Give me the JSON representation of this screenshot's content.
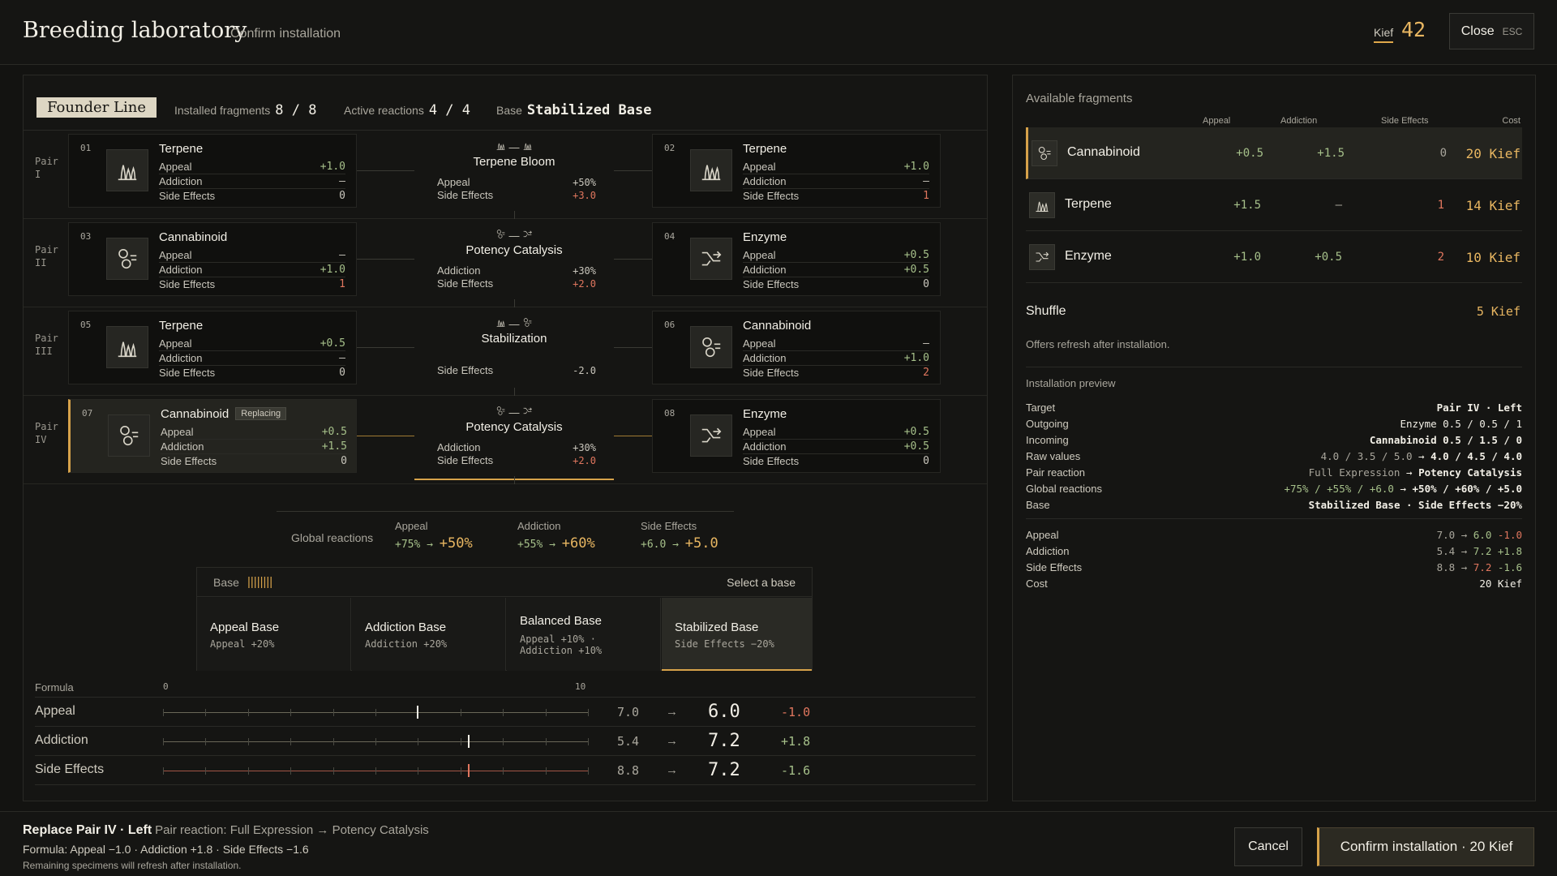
{
  "header": {
    "title": "Breeding laboratory",
    "subtitle": "Confirm installation",
    "kief_label": "Kief",
    "kief_value": "42",
    "close_label": "Close",
    "close_key": "ESC"
  },
  "line": {
    "badge": "Founder Line",
    "installed_label": "Installed fragments",
    "installed_value": "8 / 8",
    "reactions_label": "Active reactions",
    "reactions_value": "4 / 4",
    "base_label": "Base",
    "base_value": "Stabilized Base"
  },
  "pairs": [
    {
      "label": "Pair I",
      "left": {
        "num": "01",
        "name": "Terpene",
        "icon": "terpene-icon",
        "stats": [
          {
            "k": "Appeal",
            "v": "+1.0"
          },
          {
            "k": "Addiction",
            "v": "–"
          },
          {
            "k": "Side Effects",
            "v": "0"
          }
        ]
      },
      "reaction": {
        "mini_left": "terpene",
        "mini_right": "terpene",
        "name": "Terpene Bloom",
        "stats": [
          {
            "k": "Appeal",
            "v": "+50%"
          },
          {
            "k": "Side Effects",
            "v": "+3.0"
          }
        ]
      },
      "right": {
        "num": "02",
        "name": "Terpene",
        "icon": "terpene-icon",
        "stats": [
          {
            "k": "Appeal",
            "v": "+1.0"
          },
          {
            "k": "Addiction",
            "v": "–"
          },
          {
            "k": "Side Effects",
            "v": "1"
          }
        ]
      }
    },
    {
      "label": "Pair II",
      "left": {
        "num": "03",
        "name": "Cannabinoid",
        "icon": "cannabinoid-icon",
        "stats": [
          {
            "k": "Appeal",
            "v": "–"
          },
          {
            "k": "Addiction",
            "v": "+1.0"
          },
          {
            "k": "Side Effects",
            "v": "1"
          }
        ]
      },
      "reaction": {
        "mini_left": "cannabinoid",
        "mini_right": "enzyme",
        "name": "Potency Catalysis",
        "stats": [
          {
            "k": "Addiction",
            "v": "+30%"
          },
          {
            "k": "Side Effects",
            "v": "+2.0"
          }
        ]
      },
      "right": {
        "num": "04",
        "name": "Enzyme",
        "icon": "enzyme-icon",
        "stats": [
          {
            "k": "Appeal",
            "v": "+0.5"
          },
          {
            "k": "Addiction",
            "v": "+0.5"
          },
          {
            "k": "Side Effects",
            "v": "0"
          }
        ]
      }
    },
    {
      "label": "Pair III",
      "left": {
        "num": "05",
        "name": "Terpene",
        "icon": "terpene-icon",
        "stats": [
          {
            "k": "Appeal",
            "v": "+0.5"
          },
          {
            "k": "Addiction",
            "v": "–"
          },
          {
            "k": "Side Effects",
            "v": "0"
          }
        ]
      },
      "reaction": {
        "mini_left": "terpene",
        "mini_right": "cannabinoid",
        "name": "Stabilization",
        "stats": [
          {
            "k": "Side Effects",
            "v": "-2.0"
          }
        ]
      },
      "right": {
        "num": "06",
        "name": "Cannabinoid",
        "icon": "cannabinoid-icon",
        "stats": [
          {
            "k": "Appeal",
            "v": "–"
          },
          {
            "k": "Addiction",
            "v": "+1.0"
          },
          {
            "k": "Side Effects",
            "v": "2"
          }
        ]
      }
    },
    {
      "label": "Pair IV",
      "left": {
        "num": "07",
        "name": "Cannabinoid",
        "tag": "Replacing",
        "icon": "cannabinoid-icon",
        "stats": [
          {
            "k": "Appeal",
            "v": "+0.5"
          },
          {
            "k": "Addiction",
            "v": "+1.5"
          },
          {
            "k": "Side Effects",
            "v": "0"
          }
        ]
      },
      "reaction": {
        "mini_left": "cannabinoid",
        "mini_right": "enzyme",
        "name": "Potency Catalysis",
        "stats": [
          {
            "k": "Addiction",
            "v": "+30%"
          },
          {
            "k": "Side Effects",
            "v": "+2.0"
          }
        ]
      },
      "right": {
        "num": "08",
        "name": "Enzyme",
        "icon": "enzyme-icon",
        "stats": [
          {
            "k": "Appeal",
            "v": "+0.5"
          },
          {
            "k": "Addiction",
            "v": "+0.5"
          },
          {
            "k": "Side Effects",
            "v": "0"
          }
        ]
      }
    }
  ],
  "global_reactions": {
    "label": "Global reactions",
    "cols": [
      {
        "k": "Appeal",
        "from": "+75%",
        "to": "+50%"
      },
      {
        "k": "Addiction",
        "from": "+55%",
        "to": "+60%"
      },
      {
        "k": "Side Effects",
        "from": "+6.0",
        "to": "+5.0"
      }
    ]
  },
  "base": {
    "label": "Base",
    "ticks": "||||||||",
    "select_label": "Select a base",
    "options": [
      {
        "name": "Appeal Base",
        "desc1": "Appeal +20%",
        "desc2": ""
      },
      {
        "name": "Addiction Base",
        "desc1": "Addiction +20%",
        "desc2": ""
      },
      {
        "name": "Balanced Base",
        "desc1": "Appeal +10% ·",
        "desc2": "Addiction +10%"
      },
      {
        "name": "Stabilized Base",
        "desc1": "Side Effects −20%",
        "desc2": ""
      }
    ]
  },
  "formula": {
    "label": "Formula",
    "min_label": "0",
    "max_label": "10",
    "scale_max": 10,
    "rows": [
      {
        "name": "Appeal",
        "old": "7.0",
        "new": "6.0",
        "value": 6.0,
        "delta": "-1.0",
        "delta_color": "#e0765e",
        "arrow": "→"
      },
      {
        "name": "Addiction",
        "old": "5.4",
        "new": "7.2",
        "value": 7.2,
        "delta": "+1.8",
        "delta_color": "#a6c08a",
        "arrow": "→"
      },
      {
        "name": "Side Effects",
        "old": "8.8",
        "new": "7.2",
        "value": 7.2,
        "delta": "-1.6",
        "delta_color": "#a6c08a",
        "arrow": "→"
      }
    ]
  },
  "available": {
    "title": "Available fragments",
    "headers": [
      "Appeal",
      "Addiction",
      "Side Effects",
      "Cost"
    ],
    "items": [
      {
        "name": "Cannabinoid",
        "icon": "cannabinoid-icon",
        "appeal": "+0.5",
        "addiction": "+1.5",
        "side": "0",
        "side_color": "#a9a69c",
        "cost": "20 Kief"
      },
      {
        "name": "Terpene",
        "icon": "terpene-icon",
        "appeal": "+1.5",
        "addiction": "–",
        "side": "1",
        "side_color": "#e0765e",
        "cost": "14 Kief"
      },
      {
        "name": "Enzyme",
        "icon": "enzyme-icon",
        "appeal": "+1.0",
        "addiction": "+0.5",
        "side": "2",
        "side_color": "#e0765e",
        "cost": "10 Kief"
      }
    ],
    "shuffle_label": "Shuffle",
    "shuffle_cost": "5 Kief",
    "shuffle_desc": "Offers refresh after installation."
  },
  "preview": {
    "title": "Installation preview",
    "target_k": "Target",
    "target_v": "Pair IV · Left",
    "outgoing_k": "Outgoing",
    "outgoing_name": "Enzyme",
    "outgoing_v": "0.5 / 0.5 / 1",
    "incoming_k": "Incoming",
    "incoming_name": "Cannabinoid",
    "incoming_v": "0.5 / 1.5 / 0",
    "raw_k": "Raw values",
    "raw_from": "4.0 / 3.5 / 5.0",
    "raw_to": "4.0 / 4.5 / 4.0",
    "pair_k": "Pair reaction",
    "pair_from": "Full Expression",
    "pair_to": "Potency Catalysis",
    "global_k": "Global reactions",
    "global_from": "+75% / +55% / +6.0",
    "global_to": "+50% / +60% / +5.0",
    "base_k": "Base",
    "base_v": "Stabilized Base · Side Effects −20%",
    "arrow": "→",
    "appeal_k": "Appeal",
    "appeal_from": "7.0",
    "appeal_to": "6.0",
    "appeal_d": "-1.0",
    "addiction_k": "Addiction",
    "addiction_from": "5.4",
    "addiction_to": "7.2",
    "addiction_d": "+1.8",
    "side_k": "Side Effects",
    "side_from": "8.8",
    "side_to": "7.2",
    "side_d": "-1.6",
    "cost_k": "Cost",
    "cost_v": "20 Kief"
  },
  "footer": {
    "line1_strong": "Replace Pair IV · Left",
    "line1_rest": "Pair reaction: Full Expression → Potency Catalysis",
    "line2": "Formula: Appeal −1.0 · Addiction +1.8 · Side Effects −1.6",
    "line3": "Remaining specimens will refresh after installation.",
    "cancel": "Cancel",
    "confirm": "Confirm installation · 20 Kief"
  }
}
